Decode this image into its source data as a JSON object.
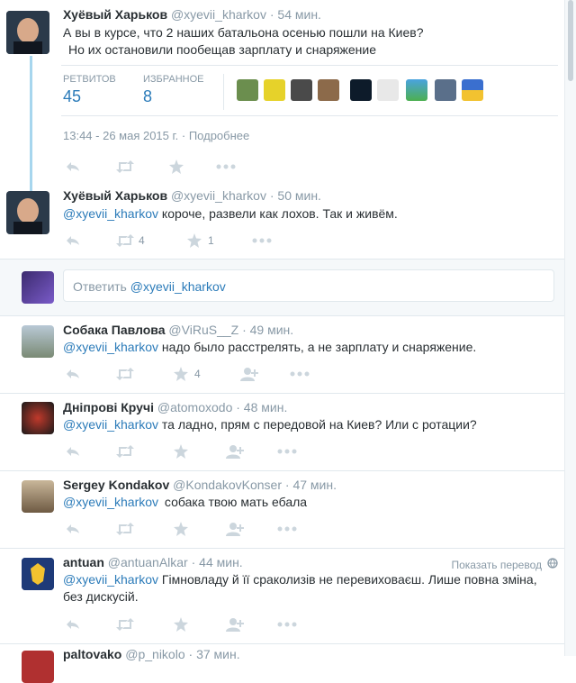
{
  "tweets": [
    {
      "name": "Хуёвый Харьков",
      "handle": "@xyevii_kharkov",
      "time": "· 54 мин.",
      "line1": "А вы в курсе, что 2 наших батальона осенью пошли на Киев?",
      "line2": "Но их остановили пообещав зарплату и снаряжение"
    },
    {
      "name": "Хуёвый Харьков",
      "handle": "@xyevii_kharkov",
      "time": "· 50 мин.",
      "mention": "@xyevii_kharkov",
      "text": "короче, развели как лохов. Так и живём.",
      "retweets": "4",
      "favorites": "1"
    },
    {
      "name": "Собака Павлова",
      "handle": "@ViRuS__Z",
      "time": "· 49 мин.",
      "mention": "@xyevii_kharkov",
      "text": "надо было расстрелять, а не зарплату и снаряжение.",
      "favorites": "4"
    },
    {
      "name": "Дніпрові Кручі",
      "handle": "@atomoxodo",
      "time": "· 48 мин.",
      "mention": "@xyevii_kharkov",
      "text": "та ладно, прям с передовой на Киев? Или с ротации?"
    },
    {
      "name": "Sergey Kondakov",
      "handle": "@KondakovKonser",
      "time": "· 47 мин.",
      "mention": "@xyevii_kharkov",
      "text": "собака твою мать ебала"
    },
    {
      "name": "antuan",
      "handle": "@antuanAlkar",
      "time": "· 44 мин.",
      "mention": "@xyevii_kharkov",
      "text": "Гімновладу й її сраколизів не перевиховаєш. Лише повна зміна,",
      "text2": "без дискусій.",
      "translate": "Показать перевод"
    },
    {
      "name": "paltovako",
      "handle": "@p_nikolo",
      "time": "· 37 мин."
    }
  ],
  "stats": {
    "retweets_label": "РЕТВИТОВ",
    "retweets": "45",
    "favorites_label": "ИЗБРАННОЕ",
    "favorites": "8"
  },
  "timestamp": "13:44 - 26 мая 2015 г. · Подробнее",
  "reply": {
    "prefix": "Ответить",
    "mention": "@xyevii_kharkov"
  },
  "colors": {
    "link": "#2b7bb9",
    "muted": "#8899a6",
    "icon": "#ccd6dd",
    "thread_line": "#a7d6ee"
  }
}
